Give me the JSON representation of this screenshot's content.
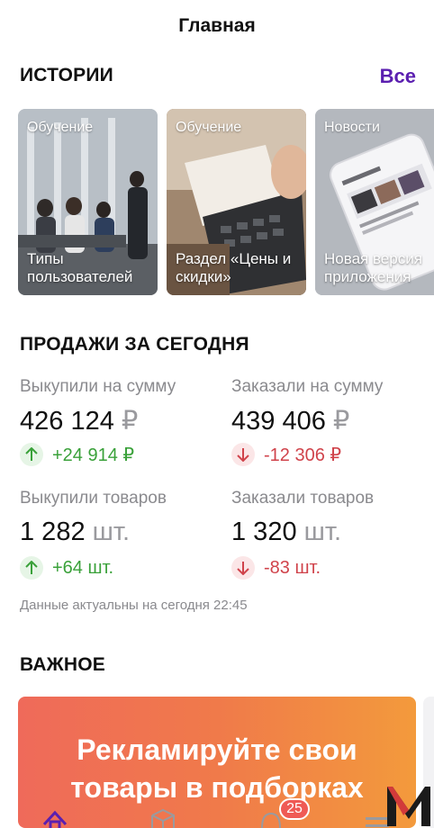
{
  "header": {
    "title": "Главная"
  },
  "stories": {
    "title": "ИСТОРИИ",
    "all_label": "Все",
    "items": [
      {
        "tag": "Обучение",
        "caption": "Типы пользователей"
      },
      {
        "tag": "Обучение",
        "caption": "Раздел «Цены и скидки»"
      },
      {
        "tag": "Новости",
        "caption": "Новая версия приложения"
      }
    ]
  },
  "sales": {
    "title": "ПРОДАЖИ ЗА СЕГОДНЯ",
    "bought_sum": {
      "label": "Выкупили на сумму",
      "value": "426 124",
      "unit": "₽",
      "delta": "+24 914 ₽",
      "direction": "up"
    },
    "ordered_sum": {
      "label": "Заказали на сумму",
      "value": "439 406",
      "unit": "₽",
      "delta": "-12 306 ₽",
      "direction": "down"
    },
    "bought_count": {
      "label": "Выкупили товаров",
      "value": "1 282",
      "unit": "шт.",
      "delta": "+64 шт.",
      "direction": "up"
    },
    "ordered_count": {
      "label": "Заказали товаров",
      "value": "1 320",
      "unit": "шт.",
      "delta": "-83 шт.",
      "direction": "down"
    },
    "note": "Данные актуальны на сегодня 22:45"
  },
  "important": {
    "title": "ВАЖНОЕ",
    "banner_line1": "Рекламируйте свои",
    "banner_line2": "товары в подборках"
  },
  "tabbar": {
    "items": [
      {
        "icon": "home-icon"
      },
      {
        "icon": "box-icon"
      },
      {
        "icon": "bell-icon",
        "badge": "25"
      },
      {
        "icon": "menu-icon"
      }
    ]
  },
  "colors": {
    "accent": "#5b1fb0",
    "up": "#3aa13a",
    "down": "#d0434b"
  }
}
